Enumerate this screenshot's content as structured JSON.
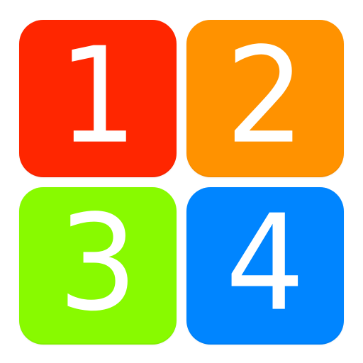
{
  "tiles": [
    {
      "label": "1",
      "color": "#ff2600"
    },
    {
      "label": "2",
      "color": "#ff9200"
    },
    {
      "label": "3",
      "color": "#88fa00"
    },
    {
      "label": "4",
      "color": "#0085ff"
    }
  ]
}
